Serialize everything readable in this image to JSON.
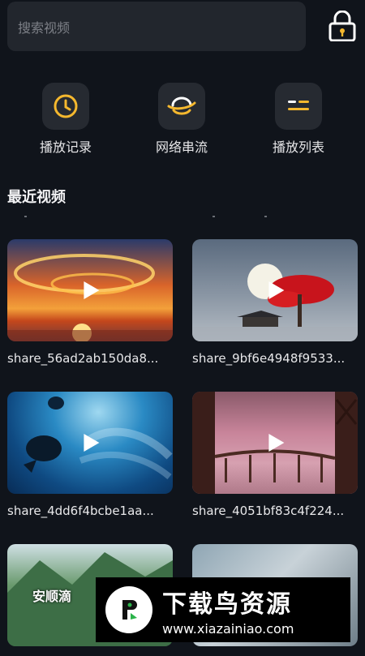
{
  "search": {
    "placeholder": "搜索视频"
  },
  "lock_icon": "lock-icon",
  "quick_actions": [
    {
      "label": "播放记录",
      "icon": "clock-icon"
    },
    {
      "label": "网络串流",
      "icon": "network-stream-icon"
    },
    {
      "label": "播放列表",
      "icon": "playlist-icon"
    }
  ],
  "recent": {
    "title": "最近视频",
    "videos": [
      {
        "name": "share_56ad2ab150da8..."
      },
      {
        "name": "share_9bf6e4948f9533..."
      },
      {
        "name": "share_4dd6f4bcbe1aa..."
      },
      {
        "name": "share_4051bf83c4f224..."
      },
      {
        "name": ""
      },
      {
        "name": ""
      }
    ],
    "overlay_text": "安顺滴"
  },
  "watermark": {
    "title": "下载鸟资源",
    "url": "www.xiazainiao.com"
  },
  "colors": {
    "background": "#10141b",
    "card": "#262a31",
    "accent": "#f5b82e"
  }
}
